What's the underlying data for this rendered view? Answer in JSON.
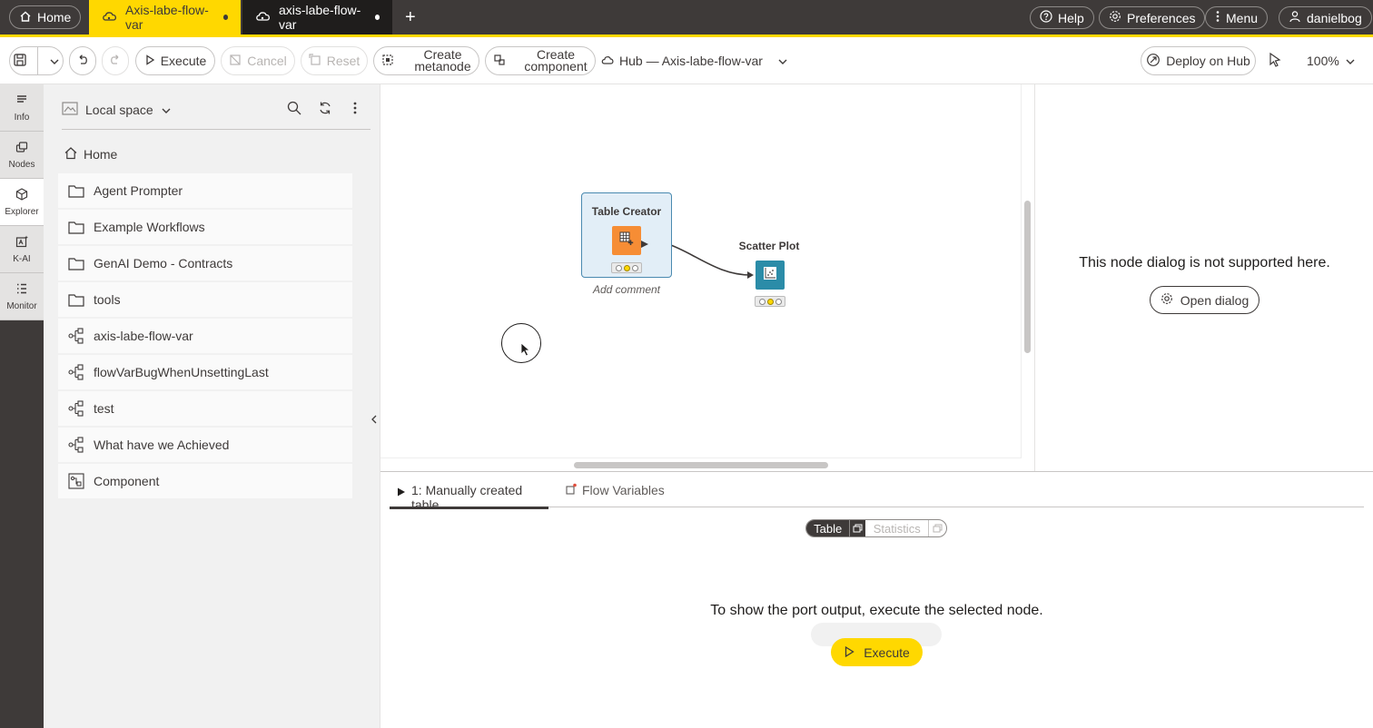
{
  "tabs": {
    "home_label": "Home",
    "active_label": "Axis-labe-flow-var",
    "inactive_label": "axis-labe-flow-var",
    "new_tab": "+"
  },
  "top_right": {
    "help": "Help",
    "preferences": "Preferences",
    "menu": "Menu",
    "user": "danielbog"
  },
  "toolbar": {
    "execute": "Execute",
    "cancel": "Cancel",
    "reset": "Reset",
    "create_metanode_1": "Create",
    "create_metanode_2": "metanode",
    "create_component_1": "Create",
    "create_component_2": "component",
    "breadcrumb": "Hub — Axis-labe-flow-var",
    "deploy": "Deploy on Hub",
    "zoom": "100%"
  },
  "rail": [
    {
      "label": "Info",
      "icon": "info-icon"
    },
    {
      "label": "Nodes",
      "icon": "nodes-icon"
    },
    {
      "label": "Explorer",
      "icon": "explorer-icon"
    },
    {
      "label": "K-AI",
      "icon": "k-ai-icon"
    },
    {
      "label": "Monitor",
      "icon": "monitor-icon"
    }
  ],
  "explorer": {
    "space": "Local space",
    "home": "Home",
    "items": [
      {
        "label": "Agent Prompter",
        "type": "folder"
      },
      {
        "label": "Example Workflows",
        "type": "folder"
      },
      {
        "label": "GenAI Demo - Contracts",
        "type": "folder"
      },
      {
        "label": "tools",
        "type": "folder"
      },
      {
        "label": "axis-labe-flow-var",
        "type": "workflow"
      },
      {
        "label": "flowVarBugWhenUnsettingLast",
        "type": "workflow"
      },
      {
        "label": "test",
        "type": "workflow"
      },
      {
        "label": "What have we Achieved",
        "type": "workflow"
      },
      {
        "label": "Component",
        "type": "component"
      }
    ]
  },
  "canvas": {
    "node1_name": "Table Creator",
    "node1_comment": "Add comment",
    "node2_name": "Scatter Plot"
  },
  "dialog_panel": {
    "message": "This node dialog is not supported here.",
    "open_dialog": "Open dialog"
  },
  "output": {
    "tab1": "1: Manually created table",
    "tab2": "Flow Variables",
    "toggle_table": "Table",
    "toggle_stats": "Statistics",
    "message": "To show the port output, execute the selected node.",
    "execute": "Execute"
  },
  "colors": {
    "accent": "#ffd800",
    "dark": "#3e3a39",
    "source_node": "#f68d35",
    "viz_node": "#2b8ca8"
  }
}
